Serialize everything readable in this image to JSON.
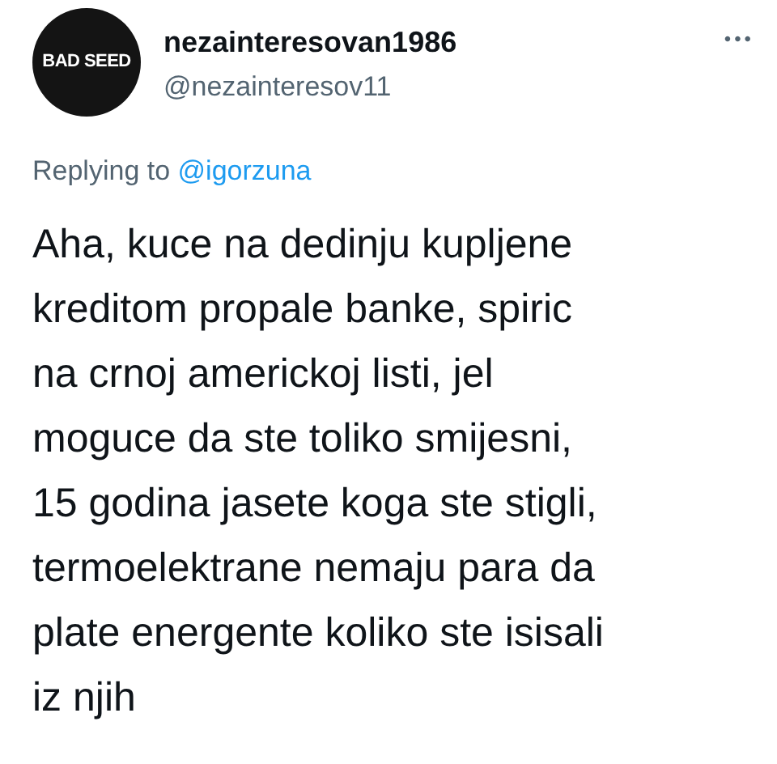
{
  "tweet": {
    "avatar_text": "BAD SEED",
    "display_name": "nezainteresovan1986",
    "handle": "@nezainteresov11",
    "more": "•••",
    "replying_label": "Replying to",
    "replying_to": "@igorzuna",
    "body": "Aha, kuce na dedinju kupljene\nkreditom propale banke, spiric\nna crnoj americkoj listi, jel\nmoguce da ste toliko smijesni,\n15 godina jasete koga ste stigli,\ntermoelektrane nemaju para da\nplate energente koliko ste isisali\niz njih"
  }
}
